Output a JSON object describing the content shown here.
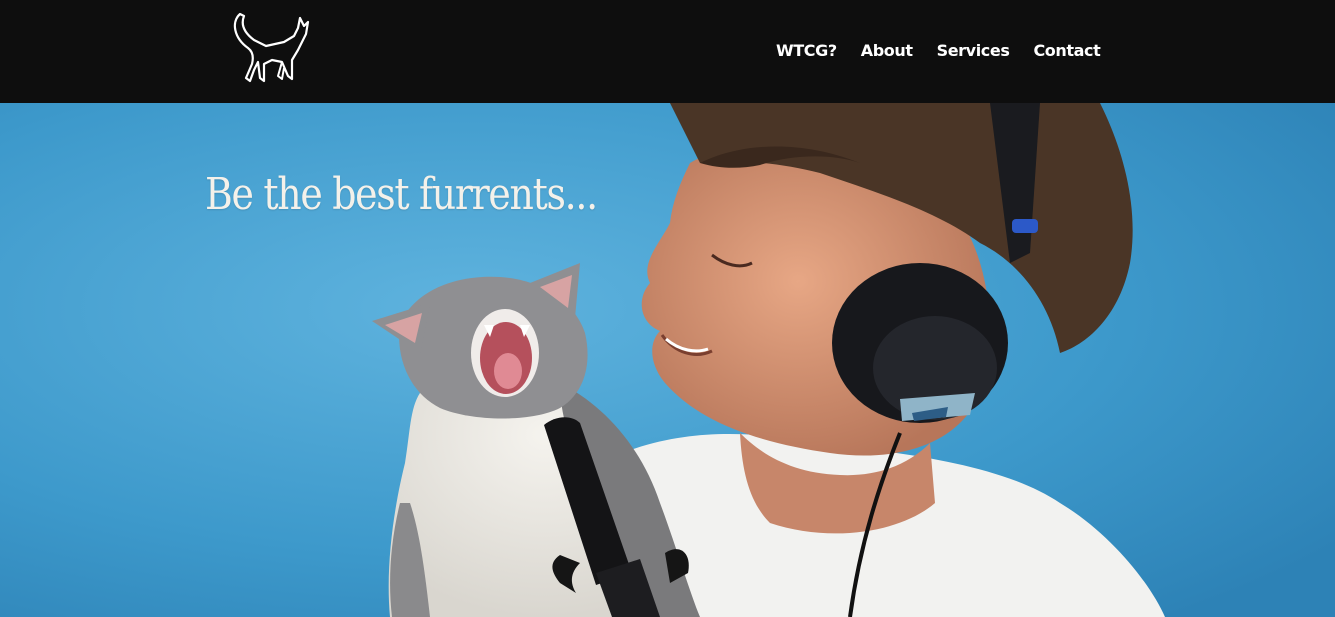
{
  "header": {
    "logo": {
      "icon": "cat-silhouette-icon"
    },
    "nav": [
      {
        "label": "WTCG?"
      },
      {
        "label": "About"
      },
      {
        "label": "Services"
      },
      {
        "label": "Contact"
      }
    ]
  },
  "hero": {
    "title": "Be the best furrents...",
    "photo": {
      "subject": "man-with-headphones-holding-meowing-kitten-icon",
      "headphone_brand": "SONY",
      "headphone_model": "Professional"
    }
  },
  "colors": {
    "header_bg": "#0e0e0e",
    "hero_bg": "#3f9bcb",
    "text_light": "#ffffff"
  }
}
